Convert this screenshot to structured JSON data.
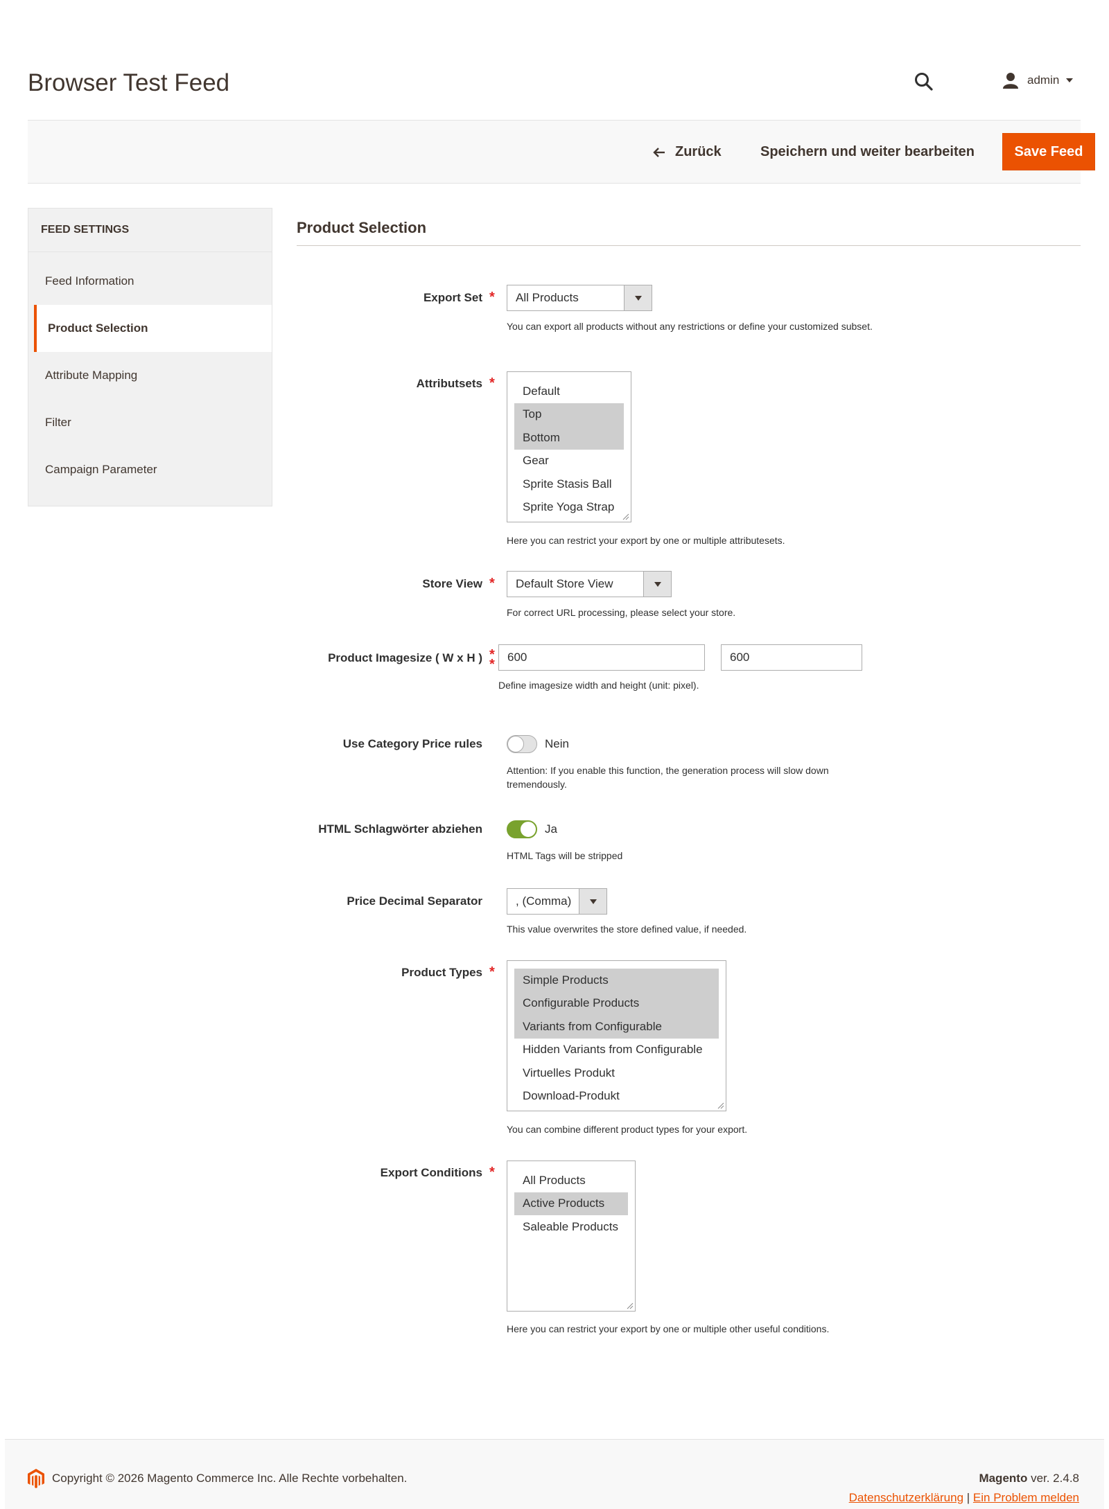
{
  "header": {
    "title": "Browser Test Feed",
    "user": "admin"
  },
  "actions": {
    "back_label": "Zurück",
    "save_continue_label": "Speichern und weiter bearbeiten",
    "save_feed_label": "Save Feed",
    "accent_color": "#eb5202"
  },
  "sidebar": {
    "title": "FEED SETTINGS",
    "items": [
      {
        "label": "Feed Information",
        "active": false
      },
      {
        "label": "Product Selection",
        "active": true
      },
      {
        "label": "Attribute Mapping",
        "active": false
      },
      {
        "label": "Filter",
        "active": false
      },
      {
        "label": "Campaign Parameter",
        "active": false
      }
    ]
  },
  "main": {
    "section_title": "Product Selection",
    "export_set": {
      "label": "Export Set",
      "value": "All Products",
      "note": "You can export all products without any restrictions or define your customized subset."
    },
    "attributesets": {
      "label": "Attributsets",
      "options": [
        {
          "label": "Default",
          "selected": false
        },
        {
          "label": "Top",
          "selected": true
        },
        {
          "label": "Bottom",
          "selected": true
        },
        {
          "label": "Gear",
          "selected": false
        },
        {
          "label": "Sprite Stasis Ball",
          "selected": false
        },
        {
          "label": "Sprite Yoga Strap",
          "selected": false
        }
      ],
      "note": "Here you can restrict your export by one or multiple attributesets."
    },
    "store_view": {
      "label": "Store View",
      "value": "Default Store View",
      "note": "For correct URL processing, please select your store."
    },
    "imagesize": {
      "label": "Product Imagesize ( W x H )",
      "width": "600",
      "height": "600",
      "note": "Define imagesize width and height (unit: pixel)."
    },
    "category_price_rules": {
      "label": "Use Category Price rules",
      "state": "Nein",
      "enabled": false,
      "note": "Attention: If you enable this function, the generation process will slow down tremendously."
    },
    "strip_html": {
      "label": "HTML Schlagwörter abziehen",
      "state": "Ja",
      "enabled": true,
      "note": "HTML Tags will be stripped"
    },
    "price_decimal": {
      "label": "Price Decimal Separator",
      "value": ", (Comma)",
      "note": "This value overwrites the store defined value, if needed."
    },
    "product_types": {
      "label": "Product Types",
      "options": [
        {
          "label": "Simple Products",
          "selected": true
        },
        {
          "label": "Configurable Products",
          "selected": true
        },
        {
          "label": "Variants from Configurable",
          "selected": true
        },
        {
          "label": "Hidden Variants from Configurable",
          "selected": false
        },
        {
          "label": "Virtuelles Produkt",
          "selected": false
        },
        {
          "label": "Download-Produkt",
          "selected": false
        }
      ],
      "note": "You can combine different product types for your export."
    },
    "export_conditions": {
      "label": "Export Conditions",
      "options": [
        {
          "label": "All Products",
          "selected": false
        },
        {
          "label": "Active Products",
          "selected": true
        },
        {
          "label": "Saleable Products",
          "selected": false
        }
      ],
      "note": "Here you can restrict your export by one or multiple other useful conditions."
    }
  },
  "footer": {
    "copyright": "Copyright © 2026 Magento Commerce Inc. Alle Rechte vorbehalten.",
    "brand": "Magento",
    "version": "ver. 2.4.8",
    "privacy_link": "Datenschutzerklärung",
    "separator": "|",
    "report_link": "Ein Problem melden"
  }
}
